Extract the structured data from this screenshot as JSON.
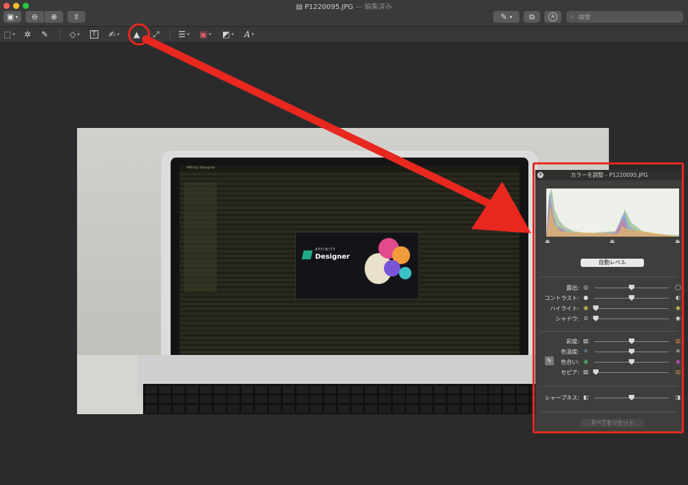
{
  "window": {
    "title": "P1220095.JPG",
    "status": "— 編集済み",
    "search_placeholder": "検索"
  },
  "toolbar_top": {
    "sidebar_icon": "sidebar-icon",
    "zoom_out_icon": "zoom-out-icon",
    "zoom_in_icon": "zoom-in-icon",
    "share_icon": "share-icon",
    "markup_icon": "pen-icon",
    "rotate_icon": "rotate-icon",
    "annotate_icon": "annotate-icon"
  },
  "markup_tools": [
    {
      "name": "rect-select-tool",
      "glyph": "⬚"
    },
    {
      "name": "instant-alpha-tool",
      "glyph": "✲"
    },
    {
      "name": "sketch-tool",
      "glyph": "✎"
    },
    {
      "name": "shapes-tool",
      "glyph": "◇"
    },
    {
      "name": "text-tool",
      "glyph": "T"
    },
    {
      "name": "sign-tool",
      "glyph": "✍"
    },
    {
      "name": "adjust-color-tool",
      "glyph": "▲"
    },
    {
      "name": "adjust-size-tool",
      "glyph": "⤢"
    },
    {
      "name": "shape-style-tool",
      "glyph": "☰"
    },
    {
      "name": "border-color-tool",
      "glyph": "▣"
    },
    {
      "name": "fill-color-tool",
      "glyph": "◩"
    },
    {
      "name": "text-style-tool",
      "glyph": "A"
    }
  ],
  "photo_screen": {
    "app_name": "Affinity Designer",
    "splash_brand": "AFFINITY",
    "splash_product": "Designer"
  },
  "panel": {
    "title": "カラーを調整 - P1220095.JPG",
    "auto_levels": "自動レベル",
    "sliders_group1": [
      {
        "label": "露出:",
        "value": 0.5
      },
      {
        "label": "コントラスト:",
        "value": 0.5
      },
      {
        "label": "ハイライト:",
        "value": 0.0
      },
      {
        "label": "シャドウ:",
        "value": 0.0
      }
    ],
    "sliders_group2": [
      {
        "label": "彩度:",
        "value": 0.5
      },
      {
        "label": "色温度:",
        "value": 0.5
      },
      {
        "label": "色合い:",
        "value": 0.5
      },
      {
        "label": "セピア:",
        "value": 0.0
      }
    ],
    "sharpness": {
      "label": "シャープネス:",
      "value": 0.5
    },
    "reset_all": "すべてをリセット"
  },
  "colors": {
    "highlight_red": "#e8281f",
    "panel_bg": "#3e3e3c"
  }
}
